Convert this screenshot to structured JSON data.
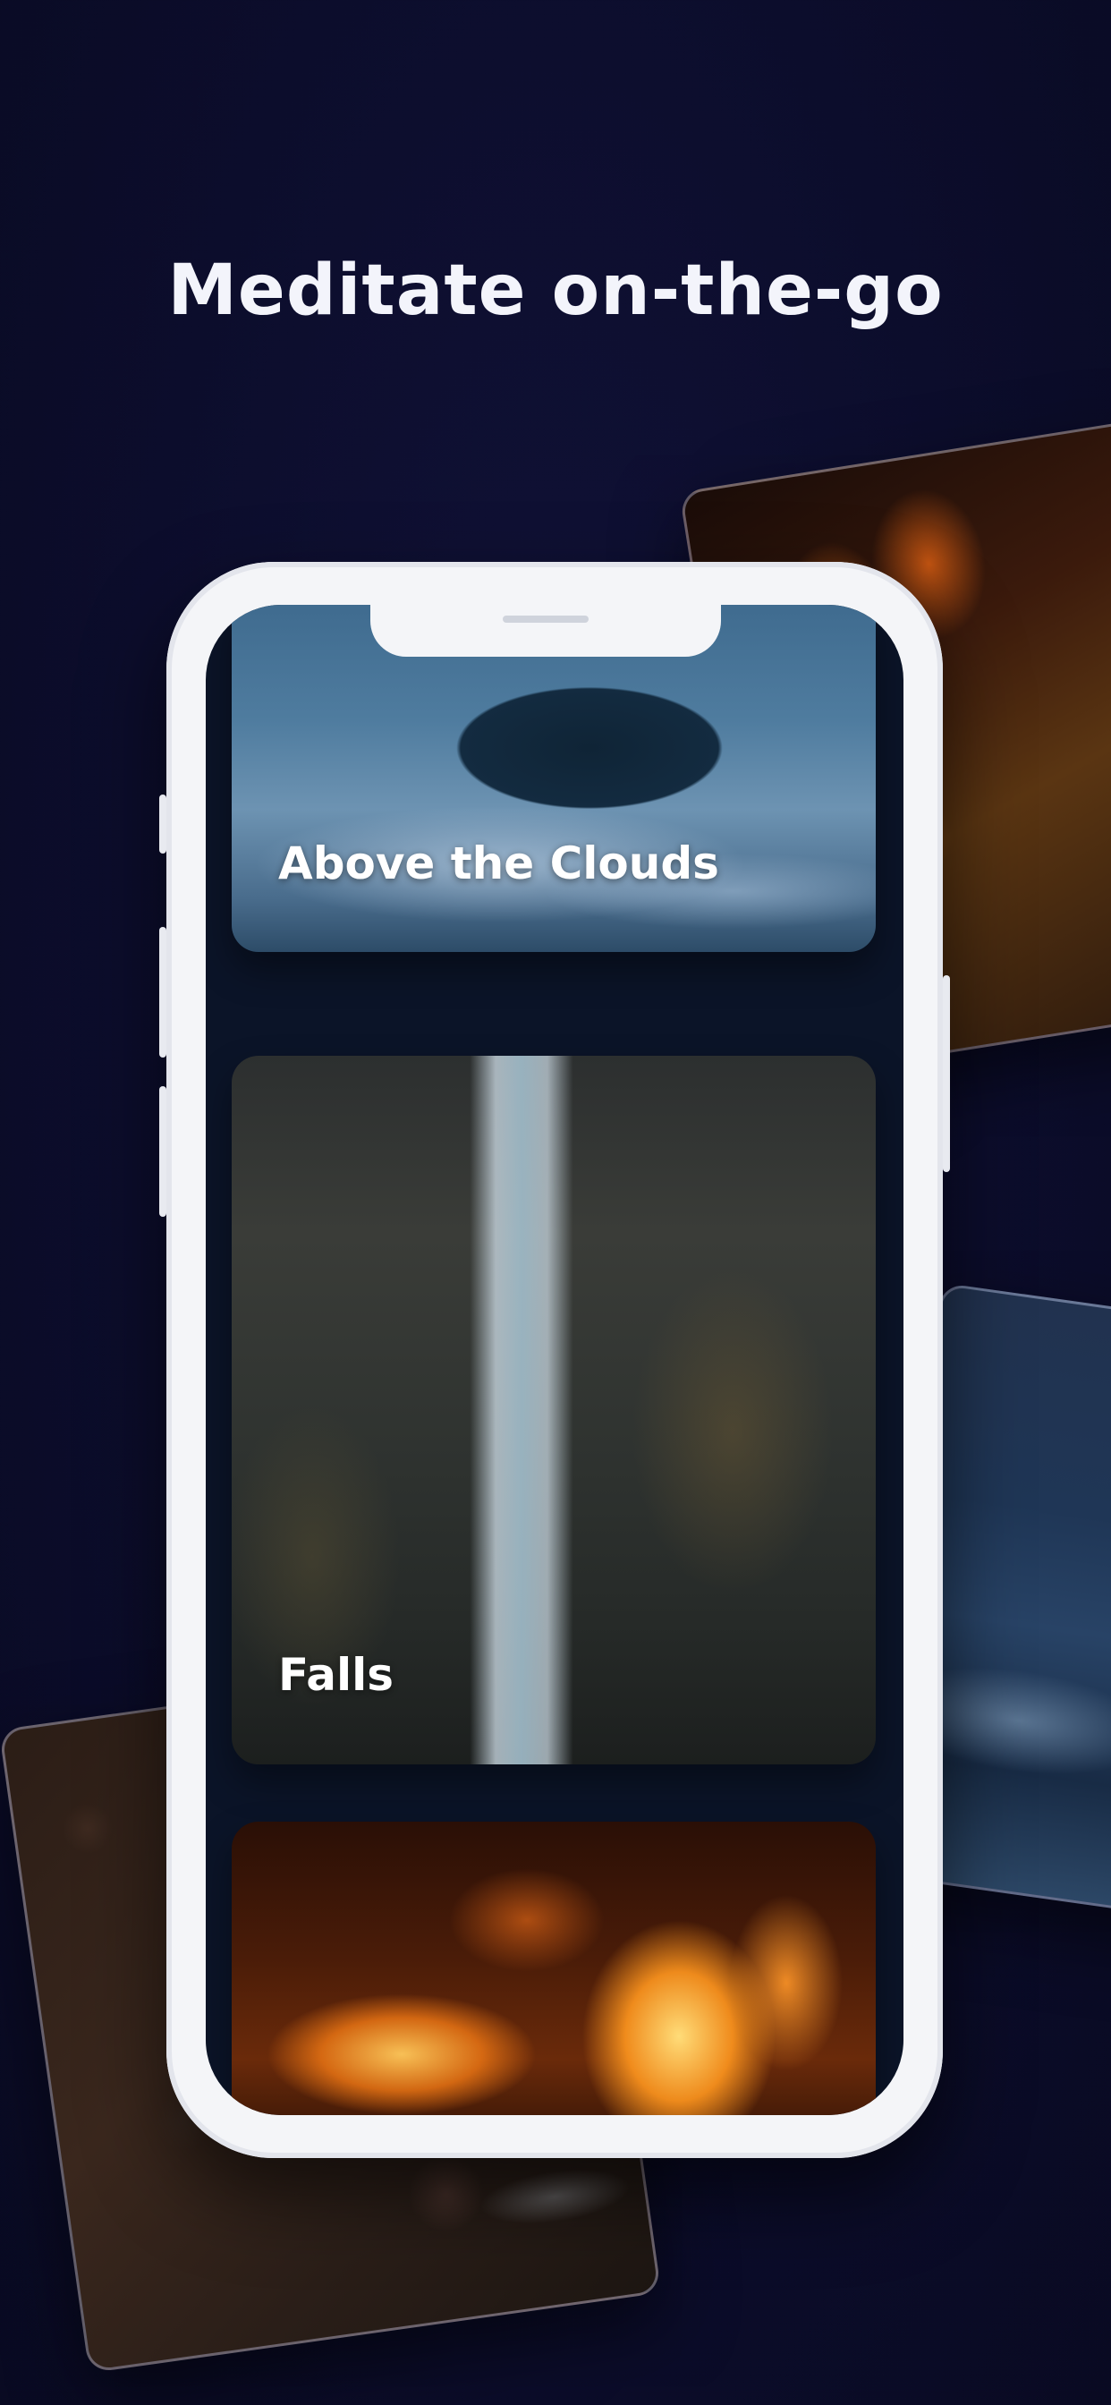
{
  "headline": "Meditate on-the-go",
  "scenes": [
    {
      "label": "Above the Clouds",
      "image": "mountain-above-clouds"
    },
    {
      "label": "Falls",
      "image": "waterfall-cliff"
    },
    {
      "label": "",
      "image": "campfire-flames"
    }
  ],
  "background_cards": [
    "campfire-flames",
    "misty-mountains",
    "river-rocks"
  ],
  "colors": {
    "background": "#0c0d2c",
    "phone_frame": "#f4f5f8",
    "screen": "#0b1428",
    "text": "#ffffff"
  }
}
